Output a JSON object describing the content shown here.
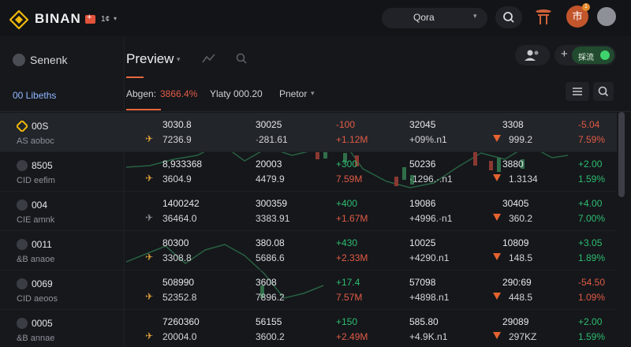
{
  "app": {
    "brand": "BINAN",
    "lang": "1¢"
  },
  "topbar": {
    "search_label": "Qora",
    "avatar_char": "市",
    "badge": "1"
  },
  "sidebar": {
    "title": "Senenk",
    "sub": "00  Libeths"
  },
  "header": {
    "title": "Preview",
    "add_label": "採流"
  },
  "filters": [
    {
      "label": "Abgen:",
      "value": "3866.4%"
    },
    {
      "label": "Ylaty 000.20"
    },
    {
      "label": "Pnetor"
    }
  ],
  "rows": [
    {
      "name": "00S",
      "sub": "AS aoboc",
      "c1a": "3030.8",
      "c1b": "7236.9",
      "c2a": "30025",
      "c2b": "·281.61",
      "c3a": "-100",
      "c3b": "+1.12M",
      "c4a": "32045",
      "c4b": "+09%.n1",
      "c5a": "3308",
      "c5b": "999.2",
      "c6a": "-5.04",
      "c6b": "7.59%",
      "dir": "dn"
    },
    {
      "name": "8505",
      "sub": "CID eefim",
      "c1a": "8,933368",
      "c1b": "3604.9",
      "c2a": "20003",
      "c2b": "4479.9",
      "c3a": "+300",
      "c3b": "7.59M",
      "c4a": "50236",
      "c4b": "·1296.·.n1",
      "c5a": "3880",
      "c5b": "1.3134",
      "c6a": "+2.00",
      "c6b": "1.59%",
      "dir": "up"
    },
    {
      "name": "004",
      "sub": "CIE amnk",
      "c1a": "1400242",
      "c1b": "36464.0",
      "c2a": "300359",
      "c2b": "3383.91",
      "c3a": "+400",
      "c3b": "+1.67M",
      "c4a": "19086",
      "c4b": "+4996.·n1",
      "c5a": "30405",
      "c5b": "360.2",
      "c6a": "+4.00",
      "c6b": "7.00%",
      "dir": "up"
    },
    {
      "name": "0011",
      "sub": "&B anaoe",
      "c1a": "80300",
      "c1b": "3308.8",
      "c2a": "380.08",
      "c2b": "5686.6",
      "c3a": "+430",
      "c3b": "+2.33M",
      "c4a": "10025",
      "c4b": "+4290.n1",
      "c5a": "10809",
      "c5b": "148.5",
      "c6a": "+3.05",
      "c6b": "1.89%",
      "dir": "up"
    },
    {
      "name": "0069",
      "sub": "CID aeoos",
      "c1a": "508990",
      "c1b": "52352.8",
      "c2a": "3608",
      "c2b": "7896.2",
      "c3a": "+17.4",
      "c3b": "7.57M",
      "c4a": "57098",
      "c4b": "+4898.n1",
      "c5a": "290:69",
      "c5b": "448.5",
      "c6a": "-54.50",
      "c6b": "1.09%",
      "dir": "dn"
    },
    {
      "name": "0005",
      "sub": "&B annae",
      "c1a": "7260360",
      "c1b": "20004.0",
      "c2a": "56155",
      "c2b": "3600.2",
      "c3a": "+150",
      "c3b": "+2.49M",
      "c4a": "585.80",
      "c4b": "+4.9K.n1",
      "c5a": "29089",
      "c5b": "297KZ",
      "c6a": "+2.00",
      "c6b": "1.59%",
      "dir": "up"
    }
  ],
  "colors": {
    "accent": "#e7683f",
    "up": "#2ebd6f",
    "down": "#e25b45",
    "brand": "#f0b90b"
  }
}
